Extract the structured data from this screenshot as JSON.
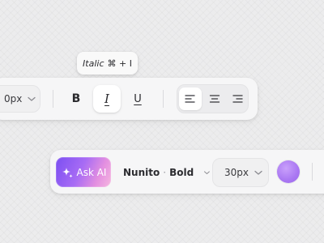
{
  "tooltip": {
    "label": "Italic",
    "shortcut": "⌘ + I"
  },
  "top_toolbar": {
    "font_size": {
      "value": "0px"
    },
    "format_buttons": [
      {
        "label": "B",
        "icon": "bold-icon"
      },
      {
        "label": "I",
        "icon": "italic-icon",
        "active": true
      },
      {
        "label": "U",
        "icon": "underline-icon"
      }
    ],
    "align_buttons": [
      {
        "icon": "align-left-icon",
        "active": true
      },
      {
        "icon": "align-center-icon"
      },
      {
        "icon": "align-right-icon"
      }
    ]
  },
  "bottom_toolbar": {
    "ask_ai": {
      "label": "Ask AI",
      "icon": "sparkle-icon"
    },
    "font": {
      "family": "Nunito",
      "separator": "·",
      "weight": "Bold"
    },
    "font_size": {
      "value": "30px"
    },
    "color": {
      "value": "#a977f2"
    }
  },
  "colors": {
    "background": "#ececed",
    "panel": "#f6f6f7",
    "accent": "#7b4ff2"
  }
}
